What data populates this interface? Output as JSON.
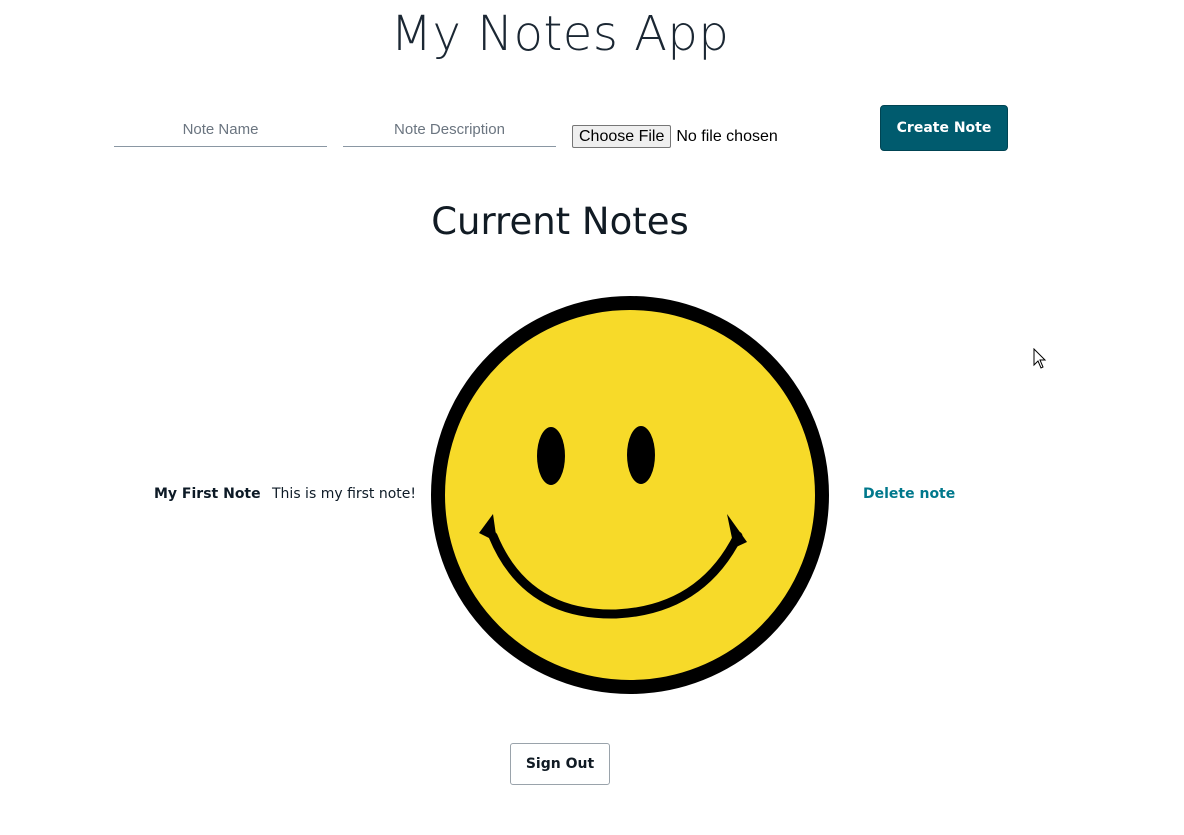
{
  "header": {
    "title": "My Notes App"
  },
  "form": {
    "note_name_placeholder": "Note Name",
    "note_description_placeholder": "Note Description",
    "choose_file_label": "Choose File",
    "file_status": "No file chosen",
    "create_button_label": "Create Note"
  },
  "notes_section": {
    "heading": "Current Notes",
    "notes": [
      {
        "name": "My First Note",
        "description": "This is my first note!",
        "image_icon": "smiley-face-icon",
        "delete_label": "Delete note"
      }
    ]
  },
  "footer": {
    "sign_out_label": "Sign Out"
  },
  "colors": {
    "primary_button": "#005b6e",
    "link": "#00788c",
    "smiley_fill": "#f7da29",
    "smiley_outline": "#000000"
  },
  "icons": {
    "cursor": "mouse-pointer-icon"
  }
}
